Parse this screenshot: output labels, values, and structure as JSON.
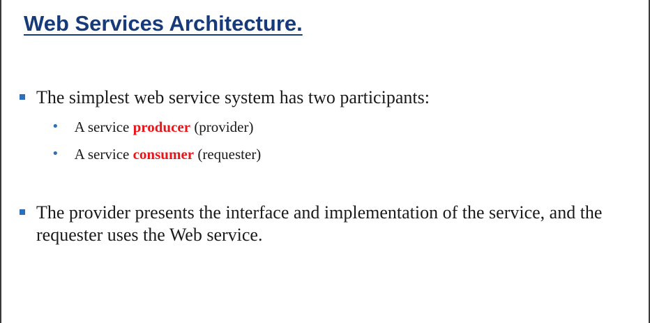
{
  "slide": {
    "title": "Web Services Architecture.",
    "bullets": [
      {
        "text": "The simplest web service system has two participants:",
        "sub": [
          {
            "prefix": "A service ",
            "emphasis": "producer",
            "suffix": " (provider)"
          },
          {
            "prefix": "A service ",
            "emphasis": "consumer",
            "suffix": " (requester)"
          }
        ]
      },
      {
        "text": "The provider presents the interface and implementation of the service, and the requester uses the Web service."
      }
    ]
  },
  "colors": {
    "title": "#163a7a",
    "bullet_marker": "#2d6fb8",
    "emphasis": "#e8161b",
    "body_text": "#1a1a1a"
  },
  "icons": {
    "level1_marker": "square-bullet-icon",
    "level2_marker": "round-bullet-icon"
  }
}
